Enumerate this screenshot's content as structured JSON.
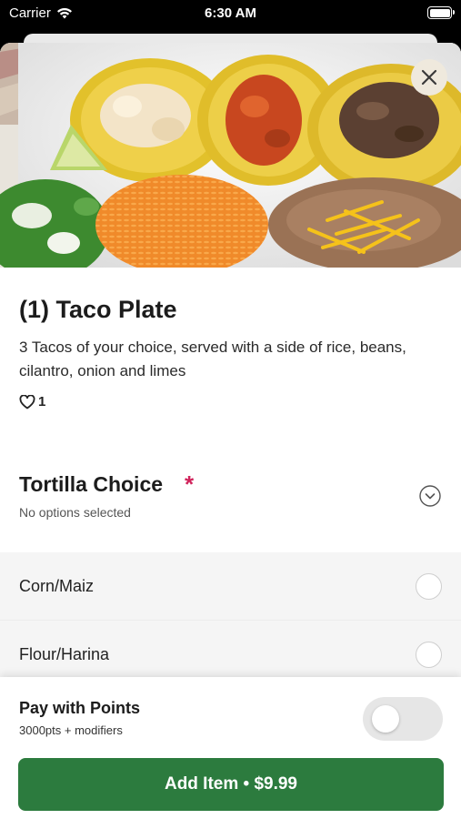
{
  "status_bar": {
    "carrier": "Carrier",
    "time": "6:30 AM"
  },
  "item": {
    "title": "(1) Taco Plate",
    "description": "3 Tacos of your choice, served with a side of rice, beans, cilantro, onion and limes",
    "likes": "1"
  },
  "options_section": {
    "title": "Tortilla Choice",
    "required_marker": "*",
    "subtitle": "No options selected",
    "options": [
      {
        "label": "Corn/Maiz"
      },
      {
        "label": "Flour/Harina"
      }
    ]
  },
  "footer": {
    "points_title": "Pay with Points",
    "points_subtitle": "3000pts + modifiers",
    "points_toggle_on": false,
    "add_button_label": "Add Item • $9.99"
  },
  "colors": {
    "brand_green": "#2c7b3e",
    "required_red": "#d0235b"
  }
}
